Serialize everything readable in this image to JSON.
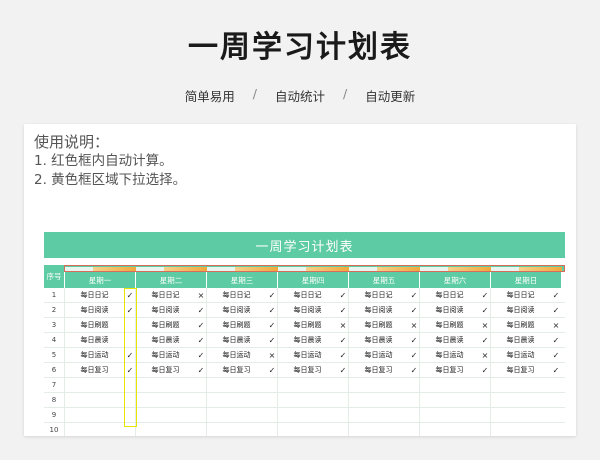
{
  "page": {
    "title": "一周学习计划表",
    "tags": [
      "简单易用",
      "自动统计",
      "自动更新"
    ],
    "separator": "/"
  },
  "instructions": {
    "title": "使用说明：",
    "lines": [
      "1. 红色框内自动计算。",
      "2. 黄色框区域下拉选择。"
    ]
  },
  "table": {
    "banner": "一周学习计划表",
    "seq_header": "序号",
    "days": [
      "星期一",
      "星期二",
      "星期三",
      "星期四",
      "星期五",
      "星期六",
      "星期日"
    ],
    "progress": [
      0.4,
      0.4,
      0.4,
      0.4,
      0.4,
      0.4,
      0.4
    ],
    "seq_numbers": [
      "1",
      "2",
      "3",
      "4",
      "5",
      "6",
      "7",
      "8",
      "9",
      "10"
    ],
    "rows": [
      {
        "seq": "1",
        "cells": [
          [
            "每日日记",
            "✓"
          ],
          [
            "每日日记",
            "×"
          ],
          [
            "每日日记",
            "✓"
          ],
          [
            "每日日记",
            "✓"
          ],
          [
            "每日日记",
            "✓"
          ],
          [
            "每日日记",
            "✓"
          ],
          [
            "每日日记",
            "✓"
          ]
        ]
      },
      {
        "seq": "2",
        "cells": [
          [
            "每日阅读",
            "✓"
          ],
          [
            "每日阅读",
            "✓"
          ],
          [
            "每日阅读",
            "✓"
          ],
          [
            "每日阅读",
            "✓"
          ],
          [
            "每日阅读",
            "✓"
          ],
          [
            "每日阅读",
            "✓"
          ],
          [
            "每日阅读",
            "✓"
          ]
        ]
      },
      {
        "seq": "3",
        "cells": [
          [
            "每日刷题",
            ""
          ],
          [
            "每日刷题",
            "✓"
          ],
          [
            "每日刷题",
            "✓"
          ],
          [
            "每日刷题",
            "×"
          ],
          [
            "每日刷题",
            "×"
          ],
          [
            "每日刷题",
            "×"
          ],
          [
            "每日刷题",
            "×"
          ]
        ]
      },
      {
        "seq": "4",
        "cells": [
          [
            "每日晨读",
            ""
          ],
          [
            "每日晨读",
            "✓"
          ],
          [
            "每日晨读",
            "✓"
          ],
          [
            "每日晨读",
            "✓"
          ],
          [
            "每日晨读",
            "✓"
          ],
          [
            "每日晨读",
            "✓"
          ],
          [
            "每日晨读",
            "✓"
          ]
        ]
      },
      {
        "seq": "5",
        "cells": [
          [
            "每日运动",
            "✓"
          ],
          [
            "每日运动",
            "✓"
          ],
          [
            "每日运动",
            "×"
          ],
          [
            "每日运动",
            "✓"
          ],
          [
            "每日运动",
            "✓"
          ],
          [
            "每日运动",
            "×"
          ],
          [
            "每日运动",
            "✓"
          ]
        ]
      },
      {
        "seq": "6",
        "cells": [
          [
            "每日复习",
            "✓"
          ],
          [
            "每日复习",
            "✓"
          ],
          [
            "每日复习",
            "✓"
          ],
          [
            "每日复习",
            "✓"
          ],
          [
            "每日复习",
            "✓"
          ],
          [
            "每日复习",
            "✓"
          ],
          [
            "每日复习",
            "✓"
          ]
        ]
      },
      {
        "seq": "7",
        "cells": []
      },
      {
        "seq": "8",
        "cells": []
      },
      {
        "seq": "9",
        "cells": []
      },
      {
        "seq": "10",
        "cells": []
      }
    ]
  },
  "colors": {
    "header_green": "#5dcba3",
    "red_frame": "#d76b5c",
    "yellow_frame": "#e6e600",
    "progress_orange": "#f0a93b"
  }
}
